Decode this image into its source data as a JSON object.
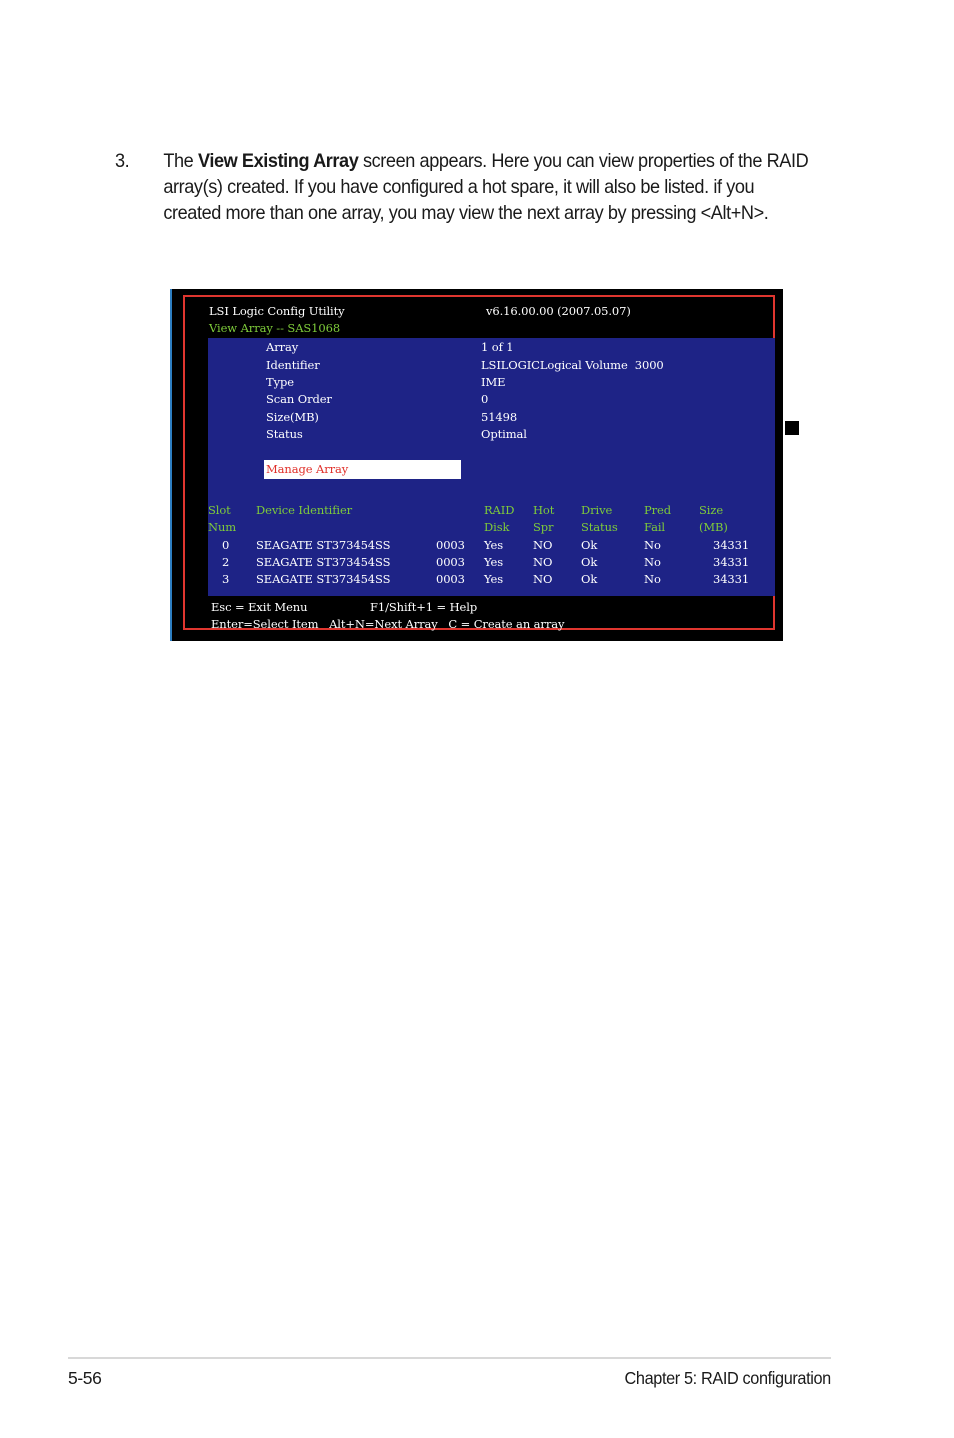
{
  "step": {
    "number": "3.",
    "text_before": "The ",
    "bold": "View Existing Array",
    "text_after": " screen appears. Here you can view properties of the RAID array(s) created. If you have configured a hot spare, it will also be listed. if you created more than one array, you may view the next array by pressing <Alt+N>."
  },
  "screen": {
    "title": "LSI Logic Config Utility",
    "version": "v6.16.00.00 (2007.05.07)",
    "subtitle": "View Array -- SAS1068",
    "properties": [
      {
        "label": "Array",
        "value": "1 of 1"
      },
      {
        "label": "Identifier",
        "value": "LSILOGICLogical Volume  3000"
      },
      {
        "label": "Type",
        "value": "IME"
      },
      {
        "label": "Scan Order",
        "value": "0"
      },
      {
        "label": "Size(MB)",
        "value": "51498"
      },
      {
        "label": "Status",
        "value": "Optimal"
      }
    ],
    "manage_button": "Manage Array",
    "table": {
      "headers": [
        {
          "line1": "Slot",
          "line2": "Num"
        },
        {
          "line1": "Device Identifier",
          "line2": ""
        },
        {
          "line1": "RAID",
          "line2": "Disk"
        },
        {
          "line1": "Hot",
          "line2": "Spr"
        },
        {
          "line1": "Drive",
          "line2": "Status"
        },
        {
          "line1": "Pred",
          "line2": "Fail"
        },
        {
          "line1": "Size",
          "line2": "(MB)"
        }
      ],
      "rows": [
        {
          "slot": "0",
          "device": "SEAGATE ST373454SS",
          "rev": "0003",
          "raid": "Yes",
          "hot": "NO",
          "status": "Ok",
          "pred": "No",
          "size": "34331"
        },
        {
          "slot": "2",
          "device": "SEAGATE ST373454SS",
          "rev": "0003",
          "raid": "Yes",
          "hot": "NO",
          "status": "Ok",
          "pred": "No",
          "size": "34331"
        },
        {
          "slot": "3",
          "device": "SEAGATE ST373454SS",
          "rev": "0003",
          "raid": "Yes",
          "hot": "NO",
          "status": "Ok",
          "pred": "No",
          "size": "34331"
        }
      ]
    },
    "footer": {
      "esc": "Esc = Exit Menu",
      "help": "F1/Shift+1 = Help",
      "line2": "Enter=Select Item   Alt+N=Next Array   C = Create an array"
    },
    "colors": {
      "panel": "#1e2386",
      "frame": "#e0362f",
      "header_text": "#7ecb3a",
      "highlight_text": "#e0302a"
    }
  },
  "page_footer": {
    "page_number": "5-56",
    "chapter": "Chapter 5: RAID configuration"
  }
}
